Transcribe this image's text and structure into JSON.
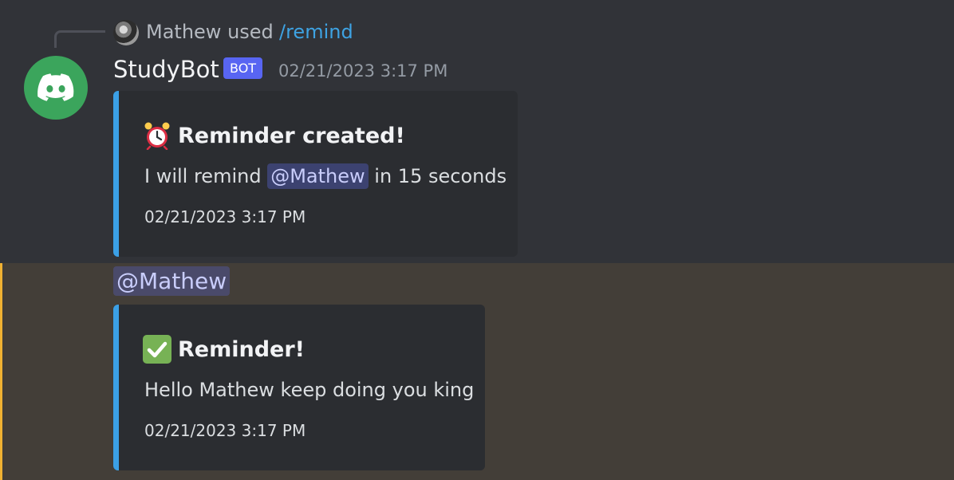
{
  "reply": {
    "user": "Mathew",
    "used_text": "used",
    "command": "/remind"
  },
  "message": {
    "author": "StudyBot",
    "badge": "BOT",
    "timestamp": "02/21/2023 3:17 PM"
  },
  "embed1": {
    "title": "Reminder created!",
    "desc_before": "I will remind",
    "mention": "@Mathew",
    "desc_after": "in 15 seconds",
    "footer": "02/21/2023 3:17 PM",
    "emoji": "alarm-clock-icon"
  },
  "followup": {
    "mention": "@Mathew"
  },
  "embed2": {
    "title": "Reminder!",
    "desc": "Hello Mathew keep doing you king",
    "footer": "02/21/2023 3:17 PM",
    "emoji": "check-mark-icon"
  },
  "colors": {
    "background": "#313338",
    "highlight": "#433e38",
    "embed_border": "#3ba0e6",
    "bot_badge": "#5865f2",
    "avatar_green": "#3ba55c"
  }
}
